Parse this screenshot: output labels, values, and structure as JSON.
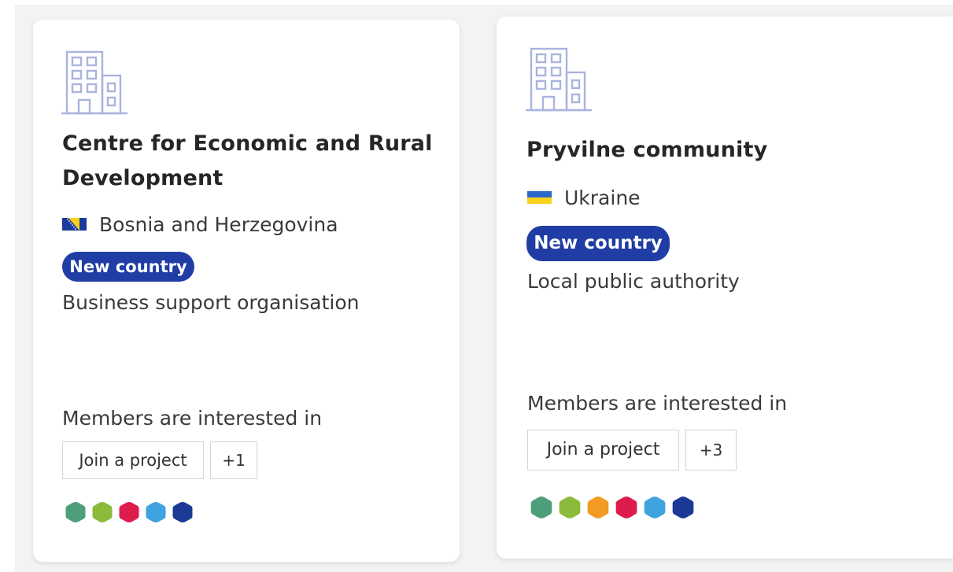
{
  "cards": [
    {
      "icon": "building-icon",
      "title": "Centre for Economic and Rural Development",
      "country": "Bosnia and Herzegovina",
      "flag_icon": "bosnia-herzegovina-flag-icon",
      "badge": "New country",
      "org_type": "Business support organisation",
      "interest_label": "Members are interested in",
      "interest_tag": "Join a project",
      "more_tag": "+1",
      "sdg_colors": [
        "#4c9f7a",
        "#8cba3b",
        "#dd1c4b",
        "#3fa3e0",
        "#1b3a95"
      ]
    },
    {
      "icon": "building-icon",
      "title": "Pryvilne community",
      "country": "Ukraine",
      "flag_icon": "ukraine-flag-icon",
      "badge": "New country",
      "org_type": "Local public authority",
      "interest_label": "Members are interested in",
      "interest_tag": "Join a project",
      "more_tag": "+3",
      "sdg_colors": [
        "#4c9f7a",
        "#8cba3b",
        "#f29a21",
        "#dd1c4b",
        "#3fa3e0",
        "#1b3a95"
      ]
    }
  ],
  "colors": {
    "badge_bg": "#1f3da4",
    "icon_stroke": "#aab4df",
    "card_bg": "#ffffff",
    "page_bg": "#f3f3f4"
  }
}
